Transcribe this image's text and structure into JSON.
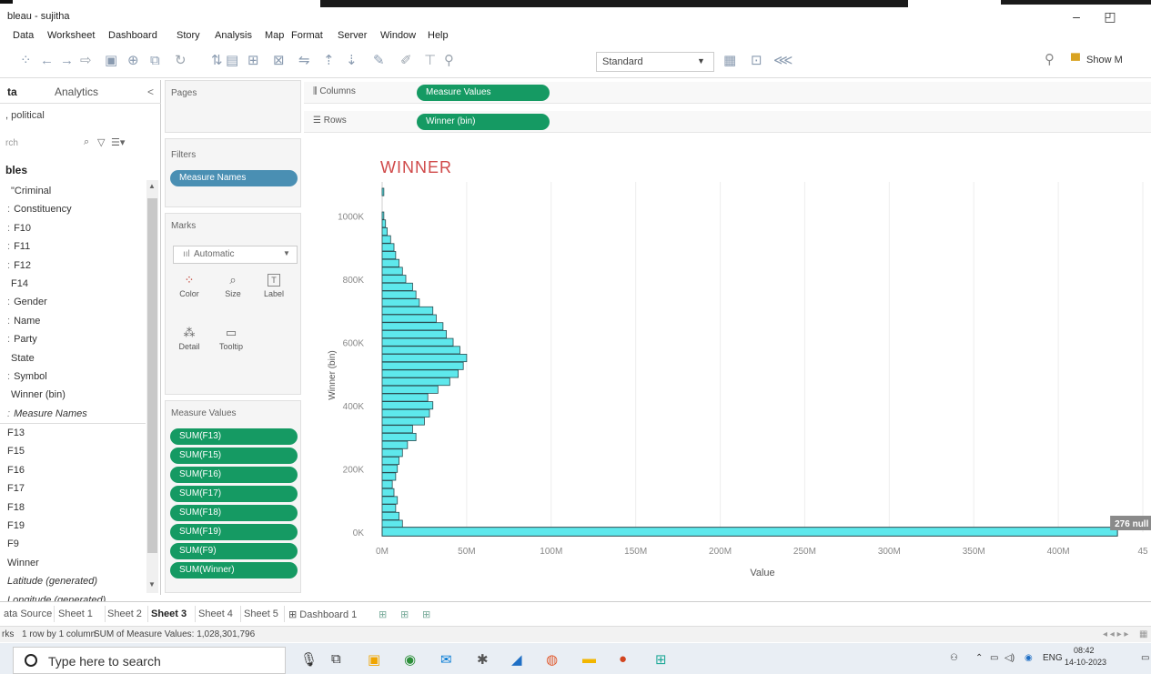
{
  "window": {
    "title": "bleau - sujitha",
    "minimize": "–",
    "restore": "◰"
  },
  "menu": [
    "Data",
    "Worksheet",
    "Dashboard",
    "Story",
    "Analysis",
    "Map",
    "Format",
    "Server",
    "Window",
    "Help"
  ],
  "toolbar": {
    "fit_mode": "Standard",
    "show_me": "Show M"
  },
  "datapane": {
    "tab_data": "ta",
    "tab_analytics": "Analytics",
    "collapse": "<",
    "source": ", political",
    "search_placeholder": "rch",
    "section": "bles",
    "fields": [
      {
        "pre": "",
        "label": "\"Criminal",
        "italic": false
      },
      {
        "pre": ":",
        "label": "Constituency",
        "italic": false
      },
      {
        "pre": ":",
        "label": "F10",
        "italic": false
      },
      {
        "pre": ":",
        "label": "F11",
        "italic": false
      },
      {
        "pre": ":",
        "label": "F12",
        "italic": false
      },
      {
        "pre": "",
        "label": "F14",
        "italic": false
      },
      {
        "pre": ":",
        "label": "Gender",
        "italic": false
      },
      {
        "pre": ":",
        "label": "Name",
        "italic": false
      },
      {
        "pre": ":",
        "label": "Party",
        "italic": false
      },
      {
        "pre": "",
        "label": "State",
        "italic": false
      },
      {
        "pre": ":",
        "label": "Symbol",
        "italic": false
      },
      {
        "pre": "",
        "label": "Winner (bin)",
        "italic": false
      },
      {
        "pre": ":",
        "label": "Measure Names",
        "italic": true
      }
    ],
    "measures": [
      {
        "label": "F13",
        "italic": false
      },
      {
        "label": "F15",
        "italic": false
      },
      {
        "label": "F16",
        "italic": false
      },
      {
        "label": "F17",
        "italic": false
      },
      {
        "label": "F18",
        "italic": false
      },
      {
        "label": "F19",
        "italic": false
      },
      {
        "label": "F9",
        "italic": false
      },
      {
        "label": "Winner",
        "italic": false
      },
      {
        "label": "Latitude (generated)",
        "italic": true
      },
      {
        "label": "Longitude (generated)",
        "italic": true
      }
    ]
  },
  "pages": {
    "title": "Pages"
  },
  "filters": {
    "title": "Filters",
    "pill": "Measure Names"
  },
  "marks": {
    "title": "Marks",
    "type": "Automatic",
    "type_icon": "ııl",
    "buttons": [
      {
        "name": "color",
        "label": "Color",
        "icon": "⁘"
      },
      {
        "name": "size",
        "label": "Size",
        "icon": "⌕"
      },
      {
        "name": "label",
        "label": "Label",
        "icon": "T"
      },
      {
        "name": "detail",
        "label": "Detail",
        "icon": "⁂"
      },
      {
        "name": "tooltip",
        "label": "Tooltip",
        "icon": "▭"
      }
    ]
  },
  "measure_values": {
    "title": "Measure Values",
    "pills": [
      "SUM(F13)",
      "SUM(F15)",
      "SUM(F16)",
      "SUM(F17)",
      "SUM(F18)",
      "SUM(F19)",
      "SUM(F9)",
      "SUM(Winner)"
    ]
  },
  "shelves": {
    "columns_label": "Columns",
    "columns_pill": "Measure Values",
    "rows_label": "Rows",
    "rows_pill": "Winner (bin)"
  },
  "chart_data": {
    "type": "bar",
    "orientation": "horizontal",
    "title": "WINNER",
    "xlabel": "Value",
    "ylabel": "Winner (bin)",
    "xlim": [
      0,
      450000000
    ],
    "x_ticks": [
      "0M",
      "50M",
      "100M",
      "150M",
      "200M",
      "250M",
      "300M",
      "350M",
      "400M",
      "45"
    ],
    "x_tick_values": [
      0,
      50000000,
      100000000,
      150000000,
      200000000,
      250000000,
      300000000,
      350000000,
      400000000,
      450000000
    ],
    "ylim": [
      0,
      1050000
    ],
    "y_ticks": [
      "0K",
      "200K",
      "400K",
      "600K",
      "800K",
      "1000K"
    ],
    "y_tick_values": [
      0,
      200000,
      400000,
      600000,
      800000,
      1000000
    ],
    "bin_size": 25000,
    "bin_values_millions": [
      [
        25000,
        12
      ],
      [
        50000,
        10
      ],
      [
        75000,
        8
      ],
      [
        100000,
        9
      ],
      [
        125000,
        7
      ],
      [
        150000,
        6
      ],
      [
        175000,
        8
      ],
      [
        200000,
        9
      ],
      [
        225000,
        10
      ],
      [
        250000,
        12
      ],
      [
        275000,
        15
      ],
      [
        300000,
        20
      ],
      [
        325000,
        18
      ],
      [
        350000,
        25
      ],
      [
        375000,
        28
      ],
      [
        400000,
        30
      ],
      [
        425000,
        27
      ],
      [
        450000,
        33
      ],
      [
        475000,
        40
      ],
      [
        500000,
        45
      ],
      [
        525000,
        48
      ],
      [
        550000,
        50
      ],
      [
        575000,
        46
      ],
      [
        600000,
        42
      ],
      [
        625000,
        38
      ],
      [
        650000,
        36
      ],
      [
        675000,
        32
      ],
      [
        700000,
        30
      ],
      [
        725000,
        22
      ],
      [
        750000,
        20
      ],
      [
        775000,
        18
      ],
      [
        800000,
        14
      ],
      [
        825000,
        12
      ],
      [
        850000,
        10
      ],
      [
        875000,
        8
      ],
      [
        900000,
        7
      ],
      [
        925000,
        5
      ],
      [
        950000,
        3
      ],
      [
        975000,
        2
      ],
      [
        1000000,
        1
      ],
      [
        1075000,
        1
      ]
    ],
    "highlight": {
      "bin": 0,
      "value_millions": 435,
      "label": "276 null"
    },
    "grid": true,
    "bar_color": "#5ee8ec"
  },
  "sheets": {
    "tabs": [
      {
        "label": "ata Source",
        "active": false
      },
      {
        "label": "Sheet 1",
        "active": false
      },
      {
        "label": "Sheet 2",
        "active": false
      },
      {
        "label": "Sheet 3",
        "active": true
      },
      {
        "label": "Sheet 4",
        "active": false
      },
      {
        "label": "Sheet 5",
        "active": false
      },
      {
        "label": "⊞ Dashboard 1",
        "active": false
      }
    ]
  },
  "status": {
    "marks": "rks",
    "rows": "1 row by 1 column",
    "sum": "SUM of Measure Values: 1,028,301,796"
  },
  "taskbar": {
    "search_placeholder": "Type here to search",
    "language": "ENG",
    "time": "08:42",
    "date": "14-10-2023"
  }
}
